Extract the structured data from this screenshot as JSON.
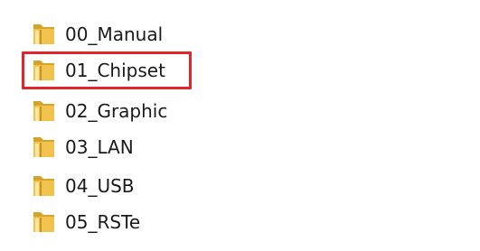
{
  "explorer": {
    "items": [
      {
        "label": "00_Manual",
        "icon": "folder-icon"
      },
      {
        "label": "01_Chipset",
        "icon": "folder-icon",
        "highlighted": true
      },
      {
        "label": "02_Graphic",
        "icon": "folder-icon"
      },
      {
        "label": "03_LAN",
        "icon": "folder-icon"
      },
      {
        "label": "04_USB",
        "icon": "folder-icon"
      },
      {
        "label": "05_RSTe",
        "icon": "folder-icon"
      }
    ],
    "colors": {
      "highlight_border": "#e0262a",
      "folder_body": "#f2c24e",
      "folder_dark": "#c9961c",
      "folder_light": "#fbe6a2"
    }
  }
}
